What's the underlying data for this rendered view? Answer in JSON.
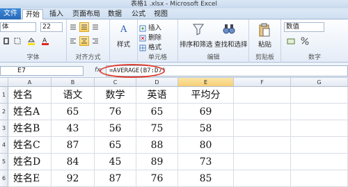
{
  "window": {
    "title": "表格1 .xlsx - Microsoft Excel"
  },
  "tabs": [
    "文件",
    "开始",
    "插入",
    "页面布局",
    "数据",
    "公式",
    "视图"
  ],
  "ribbon": {
    "font_name": "体",
    "font_size": "22",
    "font_group": "字体",
    "align_group": "对齐方式",
    "style_label": "样式",
    "cells_insert": "插入",
    "cells_delete": "删除",
    "cells_format": "格式",
    "cells_group": "单元格",
    "sort_filter": "排序和筛选",
    "find_select": "查找和选择",
    "edit_group": "编辑",
    "paste_label": "粘贴",
    "clipboard_group": "剪贴板",
    "number_format": "数值",
    "number_group": "数字"
  },
  "formula_bar": {
    "name_box": "E7",
    "fx": "fx",
    "formula": "=AVERAGE(B7:D7)"
  },
  "sheet": {
    "columns": [
      "A",
      "B",
      "C",
      "D",
      "E",
      "F",
      "G"
    ],
    "rows": [
      {
        "num": "1",
        "cells": [
          "姓名",
          "语文",
          "数学",
          "英语",
          "平均分"
        ]
      },
      {
        "num": "2",
        "cells": [
          "姓名A",
          "65",
          "76",
          "65",
          "69"
        ]
      },
      {
        "num": "3",
        "cells": [
          "姓名B",
          "43",
          "56",
          "75",
          "58"
        ]
      },
      {
        "num": "4",
        "cells": [
          "姓名C",
          "87",
          "65",
          "88",
          "80"
        ]
      },
      {
        "num": "5",
        "cells": [
          "姓名D",
          "84",
          "45",
          "89",
          "73"
        ]
      },
      {
        "num": "6",
        "cells": [
          "姓名E",
          "92",
          "87",
          "76",
          "85"
        ]
      }
    ]
  }
}
